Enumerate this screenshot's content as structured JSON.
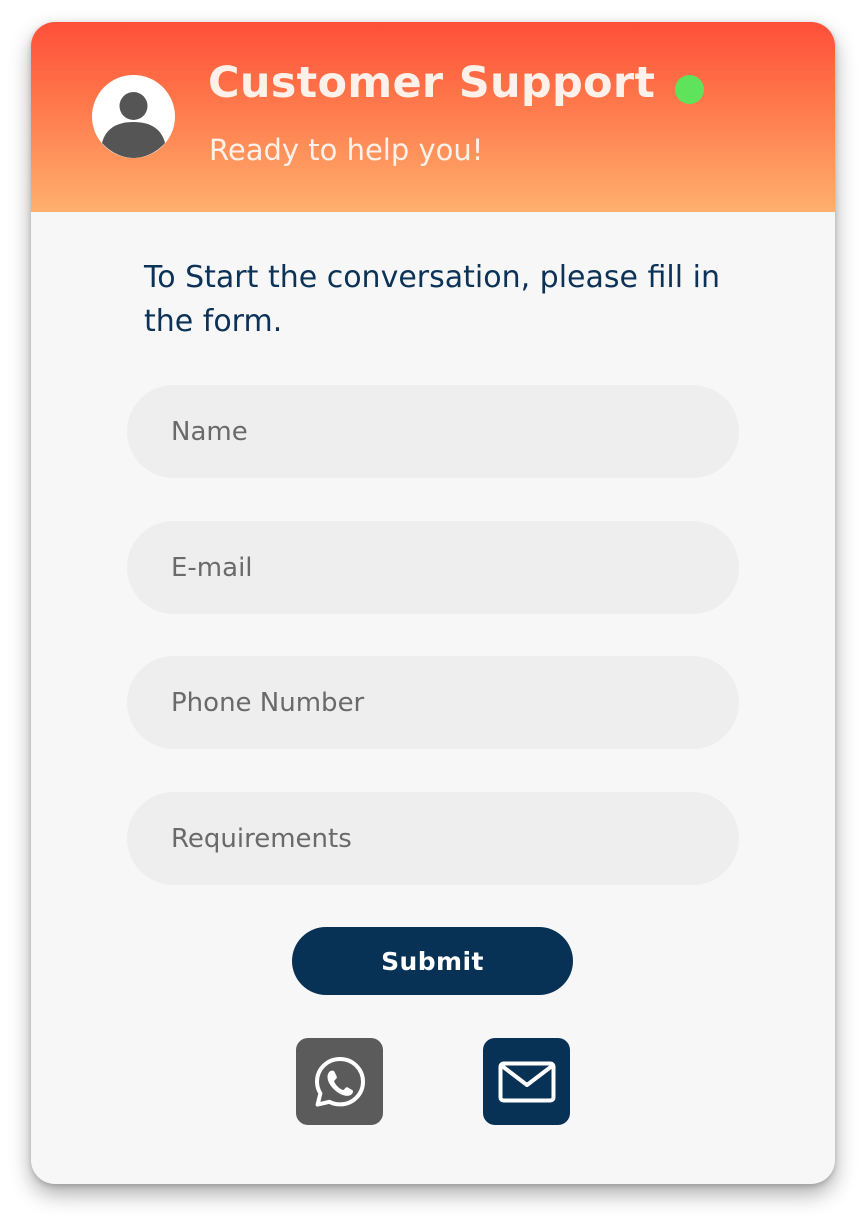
{
  "header": {
    "title": "Customer Support",
    "subtitle": "Ready to help you!",
    "status_color": "#5ee35a",
    "gradient": [
      "#ff4f39",
      "#ffb06e"
    ]
  },
  "form": {
    "intro": "To Start the conversation, please fill in the form.",
    "fields": {
      "name": {
        "placeholder": "Name",
        "value": ""
      },
      "email": {
        "placeholder": "E-mail",
        "value": ""
      },
      "phone": {
        "placeholder": "Phone Number",
        "value": ""
      },
      "requirements": {
        "placeholder": "Requirements",
        "value": ""
      }
    },
    "submit_label": "Submit",
    "submit_color": "#073155"
  },
  "contact_options": [
    {
      "icon": "whatsapp-icon",
      "color": "#5b5b5b"
    },
    {
      "icon": "mail-icon",
      "color": "#073155"
    }
  ]
}
